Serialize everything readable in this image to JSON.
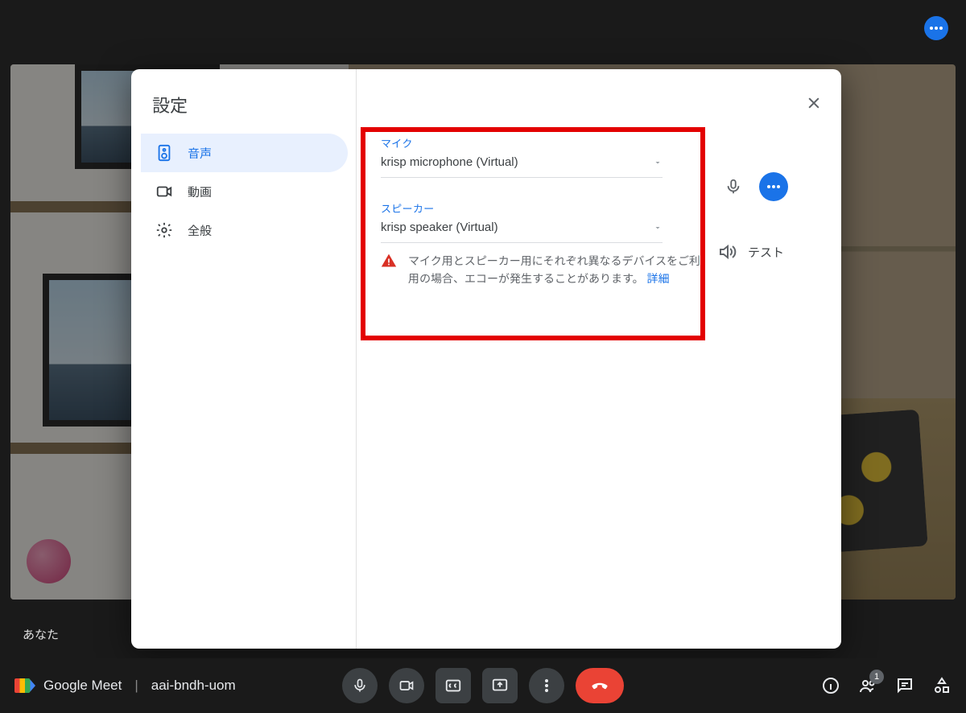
{
  "app": {
    "brand": "Google Meet",
    "meeting_code": "aai-bndh-uom",
    "you_label": "あなた",
    "participant_count": "1"
  },
  "modal": {
    "title": "設定",
    "nav": {
      "audio": "音声",
      "video": "動画",
      "general": "全般"
    },
    "mic": {
      "label": "マイク",
      "selected": "krisp microphone (Virtual)"
    },
    "speaker": {
      "label": "スピーカー",
      "selected": "krisp speaker (Virtual)",
      "test_label": "テスト"
    },
    "warning": {
      "text": "マイク用とスピーカー用にそれぞれ異なるデバイスをご利用の場合、エコーが発生することがあります。",
      "link": "詳細"
    }
  }
}
